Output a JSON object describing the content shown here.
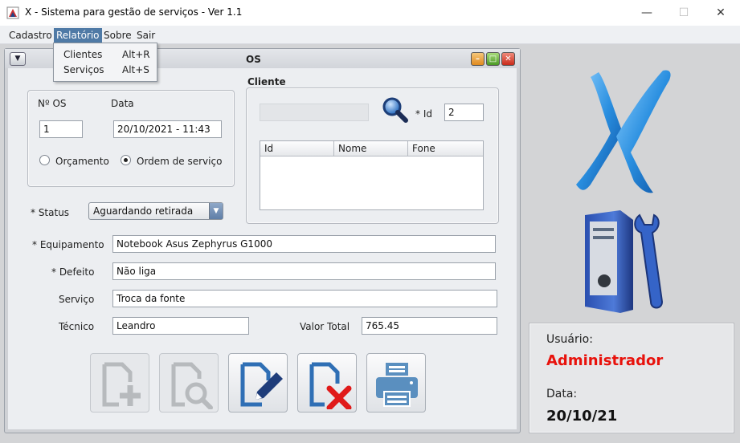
{
  "window": {
    "title": "X - Sistema para gestão de serviços - Ver 1.1",
    "minimize_label": "—",
    "maximize_label": "☐",
    "close_label": "✕"
  },
  "menubar": {
    "items": [
      "Cadastro",
      "Relatório",
      "Sobre",
      "Sair"
    ],
    "active_index": 1
  },
  "relatorio_menu": {
    "items": [
      {
        "label": "Clientes",
        "accelerator": "Alt+R"
      },
      {
        "label": "Serviços",
        "accelerator": "Alt+S"
      }
    ]
  },
  "os_form": {
    "title": "OS",
    "os_number_label": "Nº OS",
    "os_number_value": "1",
    "date_label": "Data",
    "date_value": "20/10/2021 - 11:43",
    "radio_orcamento": "Orçamento",
    "radio_ordem": "Ordem de serviço",
    "selected_type": "Ordem de serviço",
    "status_label": "* Status",
    "status_value": "Aguardando retirada",
    "cliente": {
      "group_label": "Cliente",
      "search_value": "",
      "id_label": "* Id",
      "id_value": "2",
      "columns": [
        "Id",
        "Nome",
        "Fone"
      ]
    },
    "equipamento_label": "* Equipamento",
    "equipamento_value": "Notebook Asus Zephyrus G1000",
    "defeito_label": "* Defeito",
    "defeito_value": "Não liga",
    "servico_label": "Serviço",
    "servico_value": "Troca da fonte",
    "tecnico_label": "Técnico",
    "tecnico_value": "Leandro",
    "valor_label": "Valor Total",
    "valor_value": "765.45",
    "buttons": [
      {
        "name": "add-os-button",
        "icon": "document-plus-icon",
        "enabled": false
      },
      {
        "name": "search-os-button",
        "icon": "document-search-icon",
        "enabled": false
      },
      {
        "name": "edit-os-button",
        "icon": "document-edit-icon",
        "enabled": true
      },
      {
        "name": "delete-os-button",
        "icon": "document-delete-icon",
        "enabled": true
      },
      {
        "name": "print-os-button",
        "icon": "printer-icon",
        "enabled": true
      }
    ]
  },
  "side_panel": {
    "logo_icon": "x-logo-icon",
    "tools_icon": "computer-tower-wrench-icon",
    "user_label": "Usuário:",
    "user_value": "Administrador",
    "user_color": "#e8120c",
    "date_label": "Data:",
    "date_value": "20/10/21"
  }
}
